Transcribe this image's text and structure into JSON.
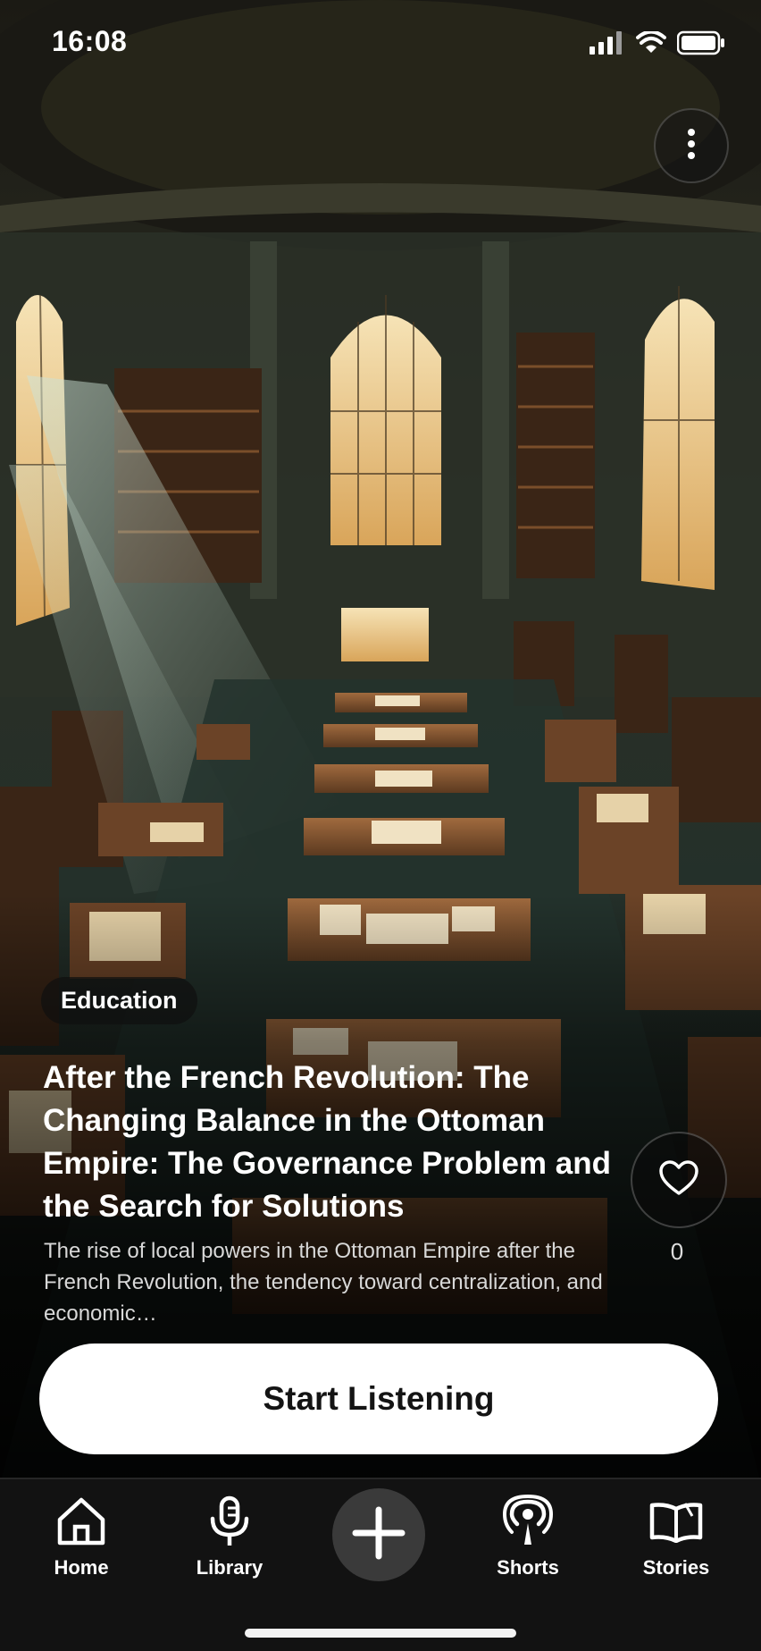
{
  "status_bar": {
    "time": "16:08"
  },
  "story": {
    "category": "Education",
    "title": "After the French Revolution: The Changing Balance in the Ottoman Empire: The Governance Problem and the Search for Solutions",
    "description": "The rise of local powers in the Ottoman Empire after the French Revolution, the tendency toward centralization, and economic…",
    "likes": "0",
    "start_label": "Start Listening"
  },
  "tabs": {
    "home": "Home",
    "library": "Library",
    "shorts": "Shorts",
    "stories": "Stories"
  },
  "icons": {
    "menu": "more-vertical-icon",
    "like": "heart-icon",
    "home": "home-icon",
    "library": "microphone-icon",
    "create": "plus-icon",
    "shorts": "podcast-icon",
    "stories": "book-open-icon"
  },
  "colors": {
    "accent_button": "#ffffff",
    "tab_bar": "#121212",
    "create_button": "#3a3a3a"
  }
}
